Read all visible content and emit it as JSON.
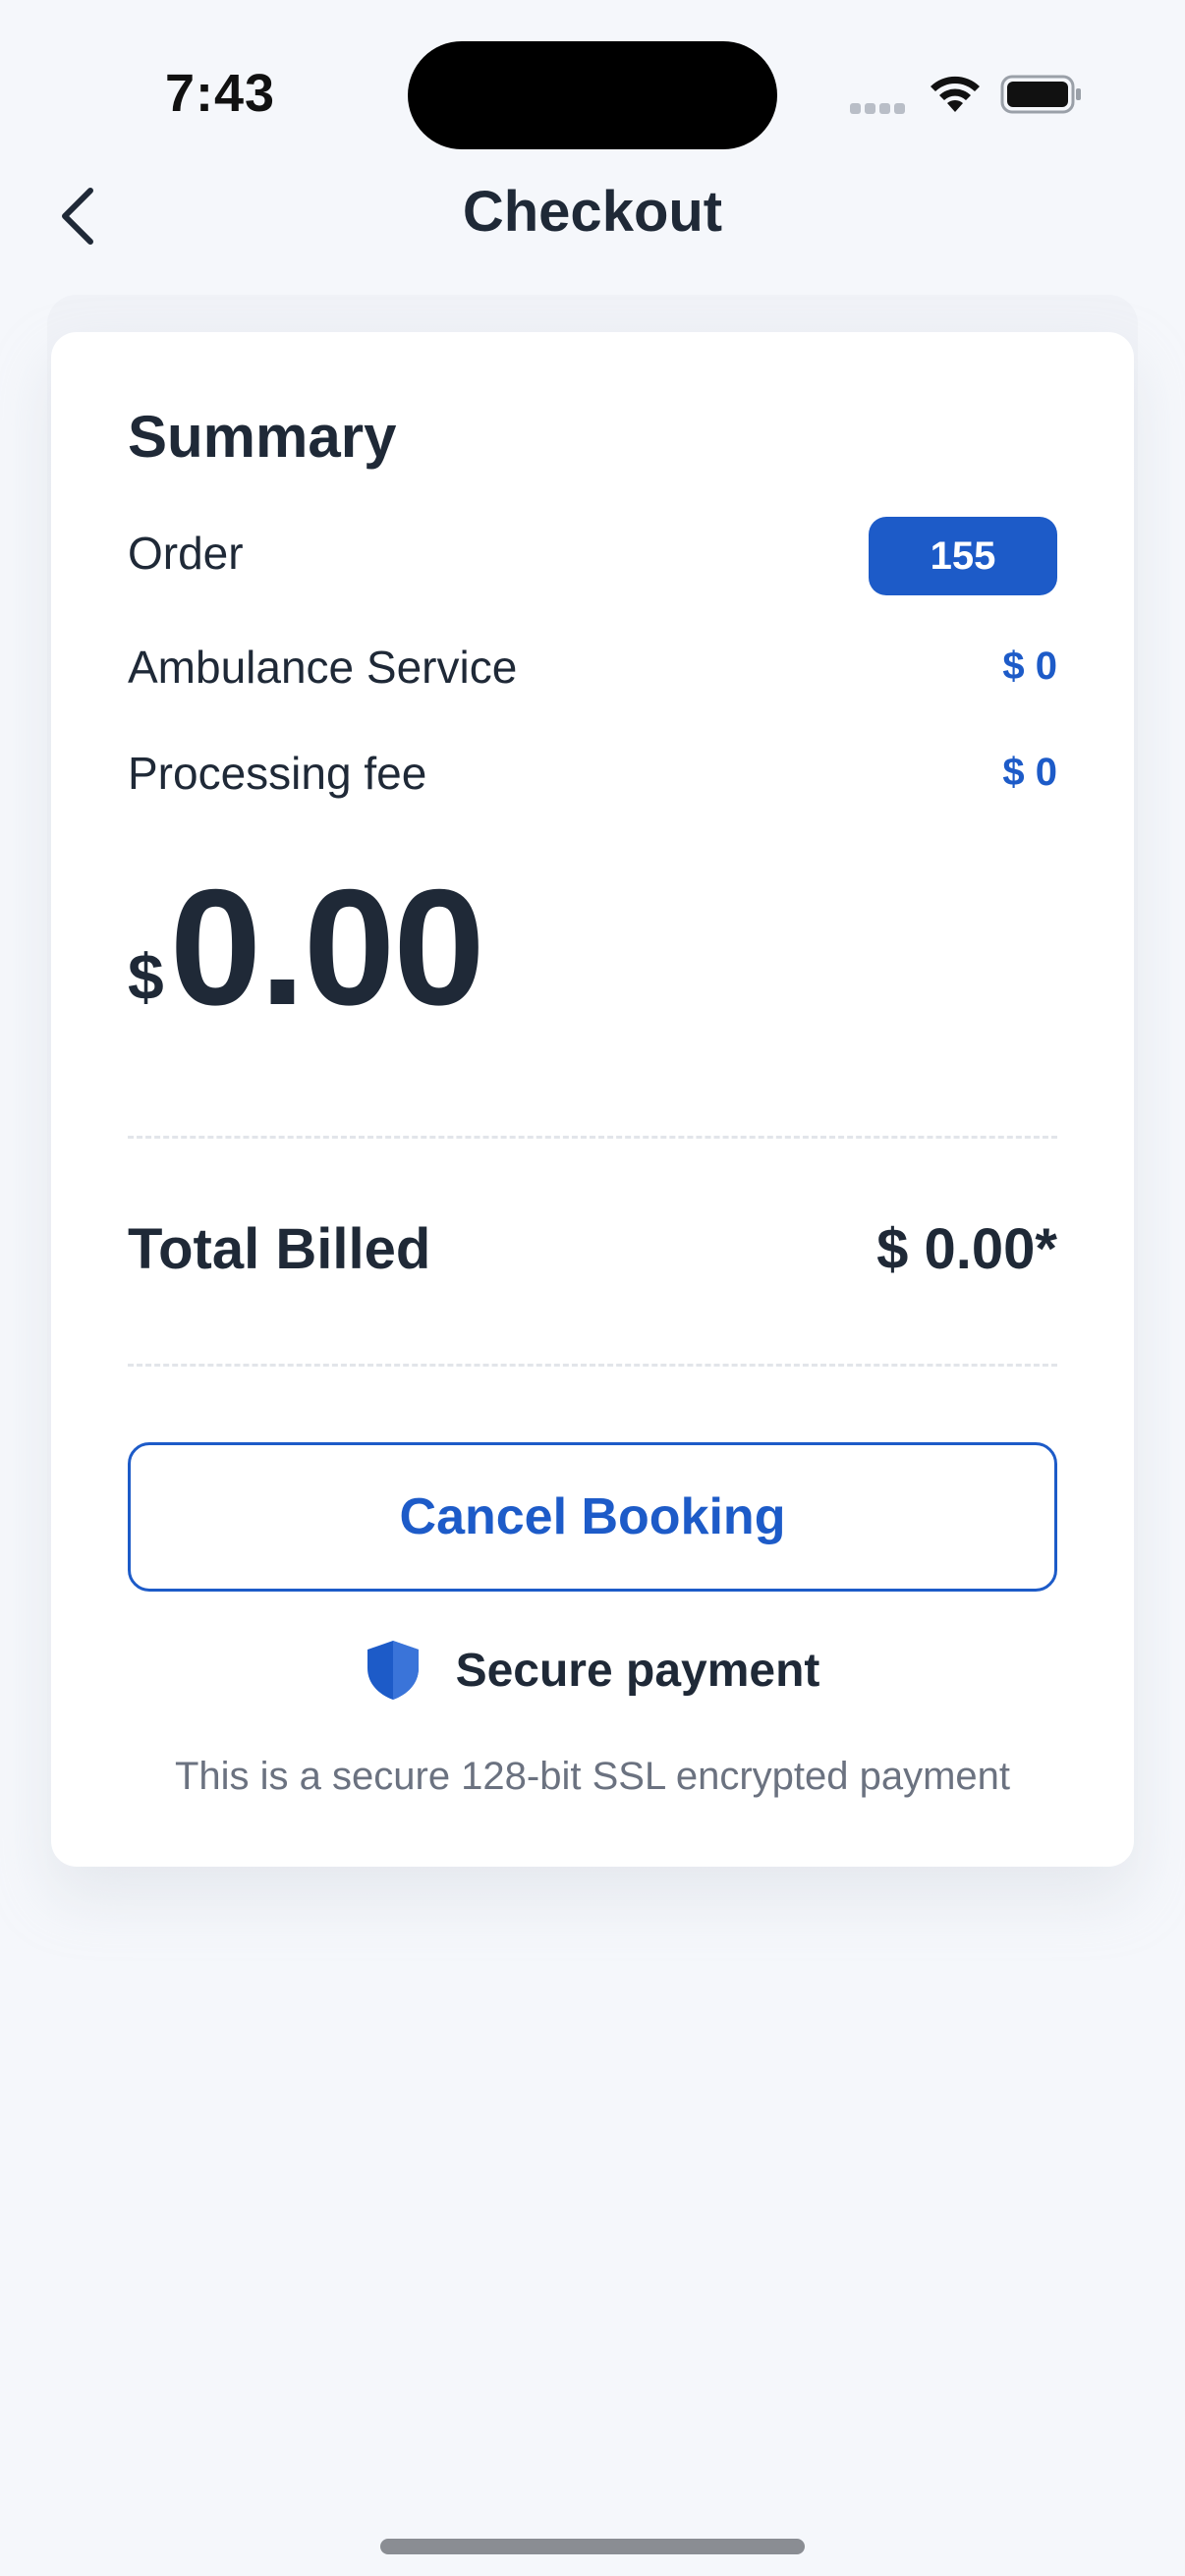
{
  "status_bar": {
    "time": "7:43"
  },
  "header": {
    "title": "Checkout",
    "back_icon": "chevron-left-icon"
  },
  "summary": {
    "title": "Summary",
    "rows": [
      {
        "label": "Order",
        "value": "155"
      },
      {
        "label": "Ambulance Service",
        "value": "$ 0"
      },
      {
        "label": "Processing fee",
        "value": "$ 0"
      }
    ],
    "amount_currency": "$",
    "amount_value": "0.00"
  },
  "total": {
    "label": "Total Billed",
    "value": "$ 0.00*"
  },
  "actions": {
    "cancel_label": "Cancel Booking"
  },
  "security": {
    "icon": "shield-icon",
    "label": "Secure payment",
    "note": "This is a secure 128-bit SSL encrypted payment"
  },
  "colors": {
    "accent": "#1d5bc8",
    "text": "#1f2937",
    "muted": "#6b7280",
    "background": "#f5f7fb"
  }
}
